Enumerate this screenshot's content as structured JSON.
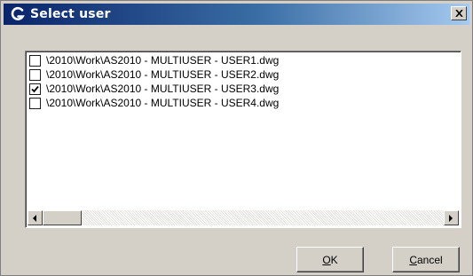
{
  "window": {
    "title": "Select user",
    "close_symbol": "×"
  },
  "files": [
    {
      "path": "\\2010\\Work\\AS2010 - MULTIUSER - USER1.dwg",
      "checked": false
    },
    {
      "path": "\\2010\\Work\\AS2010 - MULTIUSER - USER2.dwg",
      "checked": false
    },
    {
      "path": "\\2010\\Work\\AS2010 - MULTIUSER - USER3.dwg",
      "checked": true
    },
    {
      "path": "\\2010\\Work\\AS2010 - MULTIUSER - USER4.dwg",
      "checked": false
    }
  ],
  "buttons": {
    "ok": {
      "accel": "O",
      "rest": "K"
    },
    "cancel": {
      "accel": "C",
      "rest": "ancel"
    }
  },
  "icons": {
    "app": "app-logo-icon",
    "close": "close-icon",
    "checkmark": "checkmark-icon",
    "scroll_left": "arrow-left-icon",
    "scroll_right": "arrow-right-icon"
  },
  "colors": {
    "titlebar_start": "#0a246a",
    "titlebar_end": "#a6caf0",
    "dialog_face": "#d4d0c8"
  }
}
